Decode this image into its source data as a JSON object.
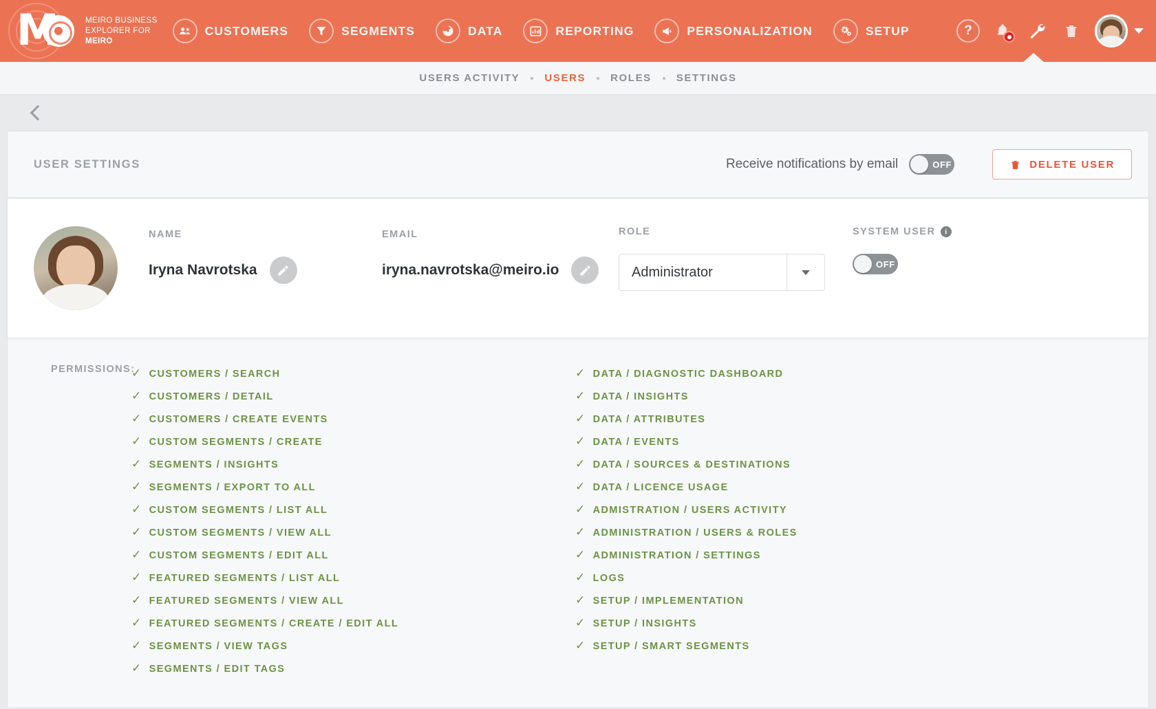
{
  "brand": {
    "line1": "MEIRO BUSINESS",
    "line2": "EXPLORER FOR",
    "line3": "MEIRO",
    "logo_icon": "meiro-logo-icon",
    "accent": "#ec7254"
  },
  "topnav": {
    "items": [
      {
        "label": "CUSTOMERS",
        "icon": "people-icon"
      },
      {
        "label": "SEGMENTS",
        "icon": "funnel-icon"
      },
      {
        "label": "DATA",
        "icon": "gauge-icon"
      },
      {
        "label": "REPORTING",
        "icon": "bar-chart-icon"
      },
      {
        "label": "PERSONALIZATION",
        "icon": "megaphone-icon"
      },
      {
        "label": "SETUP",
        "icon": "gears-icon"
      }
    ],
    "actions": [
      {
        "name": "help-icon",
        "glyph": "?"
      },
      {
        "name": "notifications-bell-icon",
        "glyph": "bell"
      },
      {
        "name": "wrench-icon",
        "glyph": "wrench"
      },
      {
        "name": "trash-icon",
        "glyph": "trash"
      }
    ],
    "avatar_alt": "user-avatar"
  },
  "subnav": {
    "items": [
      {
        "label": "USERS ACTIVITY",
        "active": false
      },
      {
        "label": "USERS",
        "active": true
      },
      {
        "label": "ROLES",
        "active": false
      },
      {
        "label": "SETTINGS",
        "active": false
      }
    ],
    "active_color": "#e8643c"
  },
  "back": {
    "icon": "chevron-left-icon"
  },
  "user_settings": {
    "title": "USER SETTINGS",
    "notifications": {
      "label": "Receive notifications by email",
      "state": "OFF"
    },
    "delete_button": {
      "label": "DELETE USER",
      "icon": "trash-icon",
      "color": "#e8563a"
    }
  },
  "user": {
    "name_label": "NAME",
    "name_value": "Iryna Navrotska",
    "name_edit_icon": "pencil-icon",
    "email_label": "EMAIL",
    "email_value": "iryna.navrotska@meiro.io",
    "email_edit_icon": "pencil-icon",
    "role_label": "ROLE",
    "role_value": "Administrator",
    "system_user_label": "SYSTEM USER",
    "system_user_info_icon": "info-icon",
    "system_user_state": "OFF",
    "avatar_alt": "user-profile-photo"
  },
  "permissions": {
    "legend": "PERMISSIONS:",
    "check_color": "#6d9246",
    "left": [
      "CUSTOMERS / SEARCH",
      "CUSTOMERS / DETAIL",
      "CUSTOMERS / CREATE EVENTS",
      "CUSTOM SEGMENTS / CREATE",
      "SEGMENTS / INSIGHTS",
      "SEGMENTS / EXPORT TO ALL",
      "CUSTOM SEGMENTS / LIST ALL",
      "CUSTOM SEGMENTS / VIEW ALL",
      "CUSTOM SEGMENTS / EDIT ALL",
      "FEATURED SEGMENTS / LIST ALL",
      "FEATURED SEGMENTS / VIEW ALL",
      "FEATURED SEGMENTS / CREATE / EDIT ALL",
      "SEGMENTS / VIEW TAGS",
      "SEGMENTS / EDIT TAGS"
    ],
    "right": [
      "DATA / DIAGNOSTIC DASHBOARD",
      "DATA / INSIGHTS",
      "DATA / ATTRIBUTES",
      "DATA / EVENTS",
      "DATA / SOURCES & DESTINATIONS",
      "DATA / LICENCE USAGE",
      "ADMISTRATION / USERS ACTIVITY",
      "ADMINISTRATION / USERS & ROLES",
      "ADMINISTRATION / SETTINGS",
      "LOGS",
      "SETUP / IMPLEMENTATION",
      "SETUP / INSIGHTS",
      "SETUP / SMART SEGMENTS"
    ]
  }
}
